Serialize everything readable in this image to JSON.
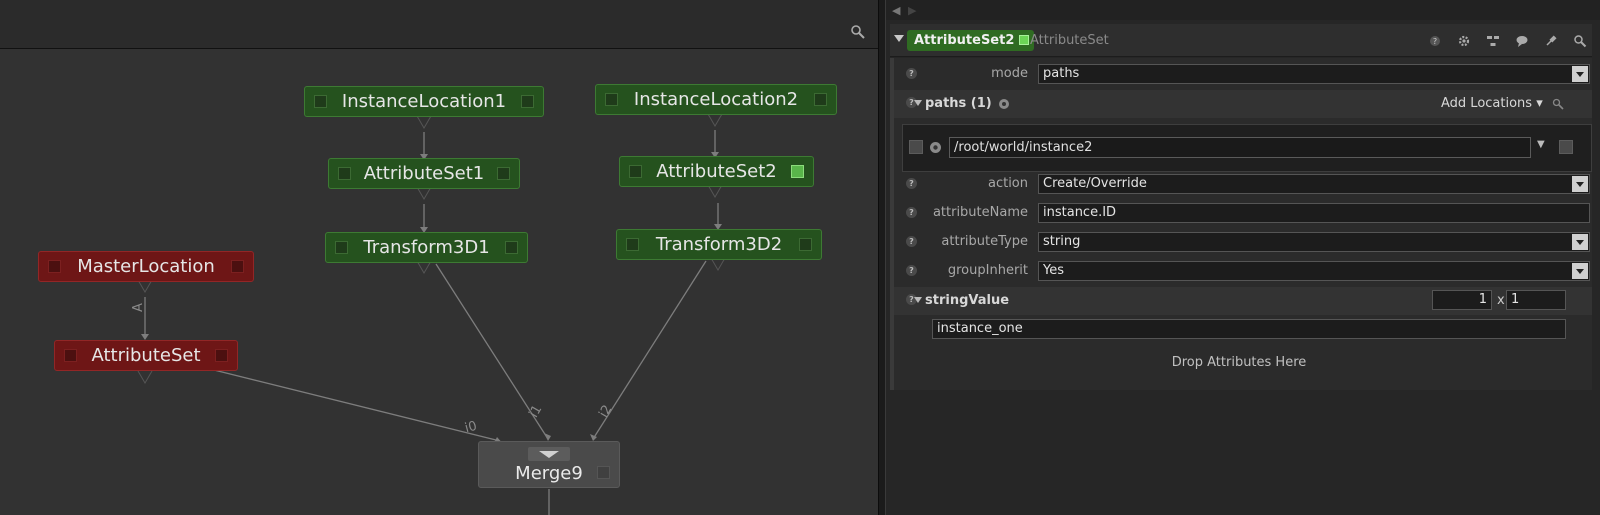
{
  "graph": {
    "nodes": {
      "instance_location_1": "InstanceLocation1",
      "instance_location_2": "InstanceLocation2",
      "attribute_set_1": "AttributeSet1",
      "attribute_set_2": "AttributeSet2",
      "transform_1": "Transform3D1",
      "transform_2": "Transform3D2",
      "master_location": "MasterLocation",
      "attribute_set": "AttributeSet",
      "merge": "Merge9"
    },
    "port_labels": {
      "a": "A",
      "i0": "i0",
      "i1": "i1",
      "i2": "i2"
    },
    "colors": {
      "active_node": "#25521e",
      "red_node": "#6e1616",
      "merge_node": "#4a4a4a"
    }
  },
  "params": {
    "node_name": "AttributeSet2",
    "node_type": "AttributeSet",
    "mode": {
      "label": "mode",
      "value": "paths"
    },
    "paths": {
      "title": "paths (1)",
      "add_locations": "Add Locations",
      "items": [
        "/root/world/instance2"
      ]
    },
    "action": {
      "label": "action",
      "value": "Create/Override"
    },
    "attribute_name": {
      "label": "attributeName",
      "value": "instance.ID"
    },
    "attribute_type": {
      "label": "attributeType",
      "value": "string"
    },
    "group_inherit": {
      "label": "groupInherit",
      "value": "Yes"
    },
    "string_value": {
      "title": "stringValue",
      "rows": "1",
      "times": "x",
      "cols": "1",
      "value": "instance_one"
    },
    "drop_text": "Drop Attributes Here"
  }
}
